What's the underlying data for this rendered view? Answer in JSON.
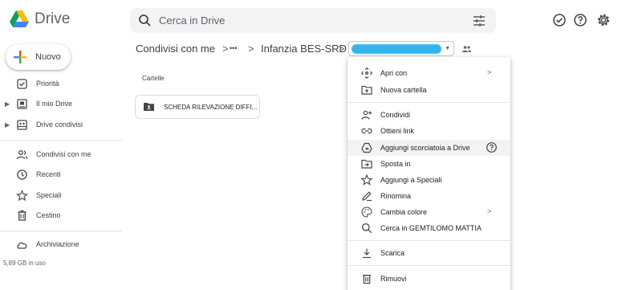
{
  "app": {
    "brand": "Drive"
  },
  "search": {
    "placeholder": "Cerca in Drive"
  },
  "top_icons": [
    "ready-offline-icon",
    "help-icon",
    "settings-icon"
  ],
  "sidebar": {
    "new_label": "Nuovo",
    "items": [
      {
        "label": "Priorità",
        "icon": "priority-icon",
        "caret": false
      },
      {
        "label": "Il mio Drive",
        "icon": "my-drive-icon",
        "caret": true
      },
      {
        "label": "Drive condivisi",
        "icon": "shared-drives-icon",
        "caret": true
      },
      {
        "label": "Condivisi con me",
        "icon": "shared-with-me-icon",
        "caret": false
      },
      {
        "label": "Recenti",
        "icon": "recent-icon",
        "caret": false
      },
      {
        "label": "Speciali",
        "icon": "star-icon",
        "caret": false
      },
      {
        "label": "Cestino",
        "icon": "trash-icon",
        "caret": false
      },
      {
        "label": "Archiviazione",
        "icon": "cloud-icon",
        "caret": false
      }
    ],
    "storage_text": "5,89 GB in uso"
  },
  "breadcrumb": {
    "items": [
      "Condivisi con me",
      "•••",
      "Infanzia BES-SRD"
    ],
    "separator": ">"
  },
  "main": {
    "section_label": "Cartelle",
    "folders": [
      {
        "name": "SCHEDA RILEVAZIONE DIFFI..."
      }
    ]
  },
  "context_menu": {
    "items": [
      {
        "label": "Apri con",
        "icon": "open-with-icon",
        "submenu": true
      },
      {
        "label": "Nuova cartella",
        "icon": "new-folder-icon",
        "submenu": false
      },
      {
        "label": "Condividi",
        "icon": "share-icon",
        "submenu": false
      },
      {
        "label": "Ottieni link",
        "icon": "link-icon",
        "submenu": false
      },
      {
        "label": "Aggiungi scorciatoia a Drive",
        "icon": "add-shortcut-icon",
        "submenu": false,
        "help": true,
        "hover": true
      },
      {
        "label": "Sposta in",
        "icon": "move-icon",
        "submenu": false
      },
      {
        "label": "Aggiungi a Speciali",
        "icon": "star-outline-icon",
        "submenu": false
      },
      {
        "label": "Rinomina",
        "icon": "rename-icon",
        "submenu": false
      },
      {
        "label": "Cambia colore",
        "icon": "palette-icon",
        "submenu": true
      },
      {
        "label": "Cerca in GEMTILOMO MATTIA",
        "icon": "search-in-icon",
        "submenu": false
      },
      {
        "label": "Scarica",
        "icon": "download-icon",
        "submenu": false
      },
      {
        "label": "Rimuovi",
        "icon": "trash-icon",
        "submenu": false
      }
    ],
    "submenu_arrow": ">"
  },
  "colors": {
    "accent": "#1a73e8",
    "hover": "#f1f3f4",
    "redacted": "#35b4ef"
  }
}
